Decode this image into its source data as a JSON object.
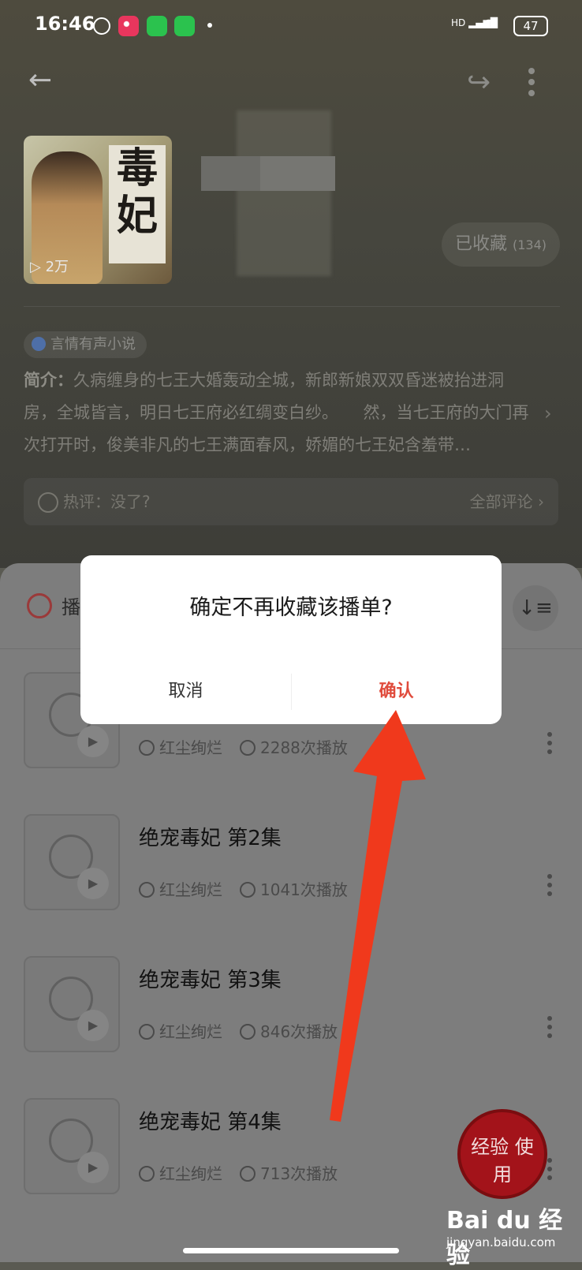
{
  "status_bar": {
    "time": "16:46",
    "battery": "47",
    "network": "HD"
  },
  "album": {
    "cover_art_text": "毒妃",
    "cover_plays": "▷ 2万",
    "favorite_label": "已收藏",
    "favorite_count": "(134)",
    "category_tag": "言情有声小说",
    "intro_label": "简介：",
    "intro_text": "久病缠身的七王大婚轰动全城，新郎新娘双双昏迷被抬进洞房，全城皆言，明日七王府必红绸变白纱。　　然，当七王府的大门再次打开时，俊美非凡的七王满面春风，娇媚的七王妃含羞带…",
    "hot_review": "热评：没了?",
    "all_reviews": "全部评论 ›"
  },
  "list": {
    "header_label": "播",
    "episodes": [
      {
        "title": "",
        "author": "红尘绚烂",
        "plays": "2288次播放"
      },
      {
        "title": "绝宠毒妃 第2集",
        "author": "红尘绚烂",
        "plays": "1041次播放"
      },
      {
        "title": "绝宠毒妃 第3集",
        "author": "红尘绚烂",
        "plays": "846次播放"
      },
      {
        "title": "绝宠毒妃 第4集",
        "author": "红尘绚烂",
        "plays": "713次播放"
      }
    ]
  },
  "dialog": {
    "title": "确定不再收藏该播单?",
    "cancel": "取消",
    "confirm": "确认"
  },
  "watermark": {
    "brand": "Bai du 经验",
    "url": "jingyan.baidu.com",
    "stamp": "经验 使用"
  },
  "colors": {
    "accent": "#e04b3c",
    "arrow": "#f0391c"
  }
}
